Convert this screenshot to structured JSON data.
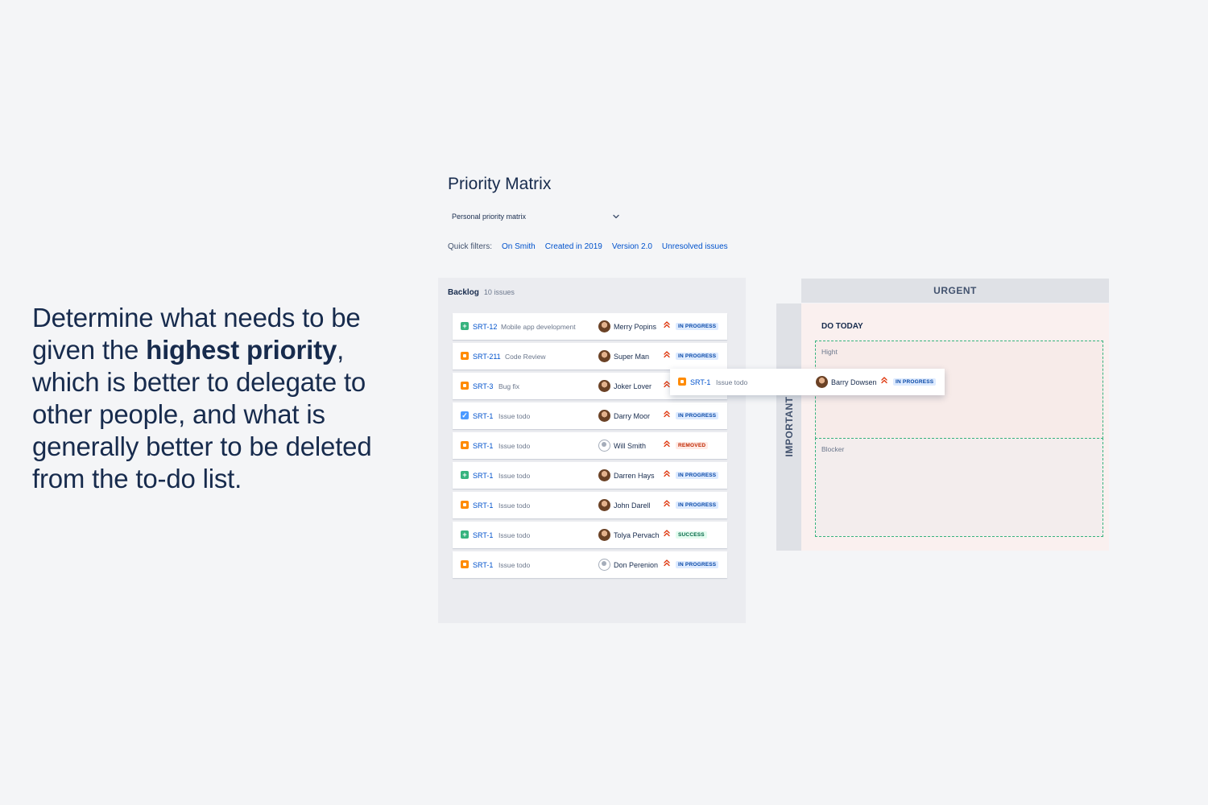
{
  "hero": {
    "part1": "Determine what needs to be given the ",
    "bold": "highest priority",
    "part2": ", which is better to delegate to other people, and what is generally better to be deleted from the to-do list."
  },
  "page_title": "Priority Matrix",
  "matrix_select": {
    "value": "Personal priority matrix",
    "icon": "chevron-down-icon"
  },
  "quick_filters": {
    "label": "Quick filters:",
    "items": [
      "On Smith",
      "Created in 2019",
      "Version 2.0",
      "Unresolved issues"
    ]
  },
  "backlog": {
    "title": "Backlog",
    "count": "10 issues",
    "rows": [
      {
        "type": "story",
        "key": "SRT-12",
        "summary": "Mobile app development",
        "assignee": "Merry Popins",
        "avatar": "photo",
        "status": "IN PROGRESS"
      },
      {
        "type": "bug",
        "key": "SRT-211",
        "summary": "Code Review",
        "assignee": "Super Man",
        "avatar": "photo",
        "status": "IN PROGRESS"
      },
      {
        "type": "bug",
        "key": "SRT-3",
        "summary": "Bug fix",
        "assignee": "Joker Lover",
        "avatar": "photo",
        "status": ""
      },
      {
        "type": "task",
        "key": "SRT-1",
        "summary": "Issue todo",
        "assignee": "Darry Moor",
        "avatar": "photo",
        "status": "IN PROGRESS"
      },
      {
        "type": "bug",
        "key": "SRT-1",
        "summary": "Issue todo",
        "assignee": "Will Smith",
        "avatar": "empty",
        "status": "REMOVED"
      },
      {
        "type": "story",
        "key": "SRT-1",
        "summary": "Issue todo",
        "assignee": "Darren Hays",
        "avatar": "photo",
        "status": "IN PROGRESS"
      },
      {
        "type": "bug",
        "key": "SRT-1",
        "summary": "Issue todo",
        "assignee": "John Darell",
        "avatar": "photo",
        "status": "IN PROGRESS"
      },
      {
        "type": "story",
        "key": "SRT-1",
        "summary": "Issue todo",
        "assignee": "Tolya Pervach",
        "avatar": "photo",
        "status": "SUCCESS"
      },
      {
        "type": "bug",
        "key": "SRT-1",
        "summary": "Issue todo",
        "assignee": "Don Perenion",
        "avatar": "empty",
        "status": "IN PROGRESS"
      }
    ]
  },
  "matrix": {
    "urgent_label": "URGENT",
    "important_label": "IMPORTANT",
    "quadrant_title": "DO TODAY",
    "zones": [
      "Hight",
      "Blocker"
    ]
  },
  "dragged_card": {
    "type": "bug",
    "key": "SRT-1",
    "summary": "Issue todo",
    "assignee": "Barry Dowsen",
    "avatar": "photo",
    "status": "IN PROGRESS"
  },
  "colors": {
    "link": "#0052cc",
    "in_progress": "#0747a6",
    "removed": "#bf2600",
    "success": "#006644",
    "priority": "#de350b",
    "zone_border": "#36b37e"
  }
}
